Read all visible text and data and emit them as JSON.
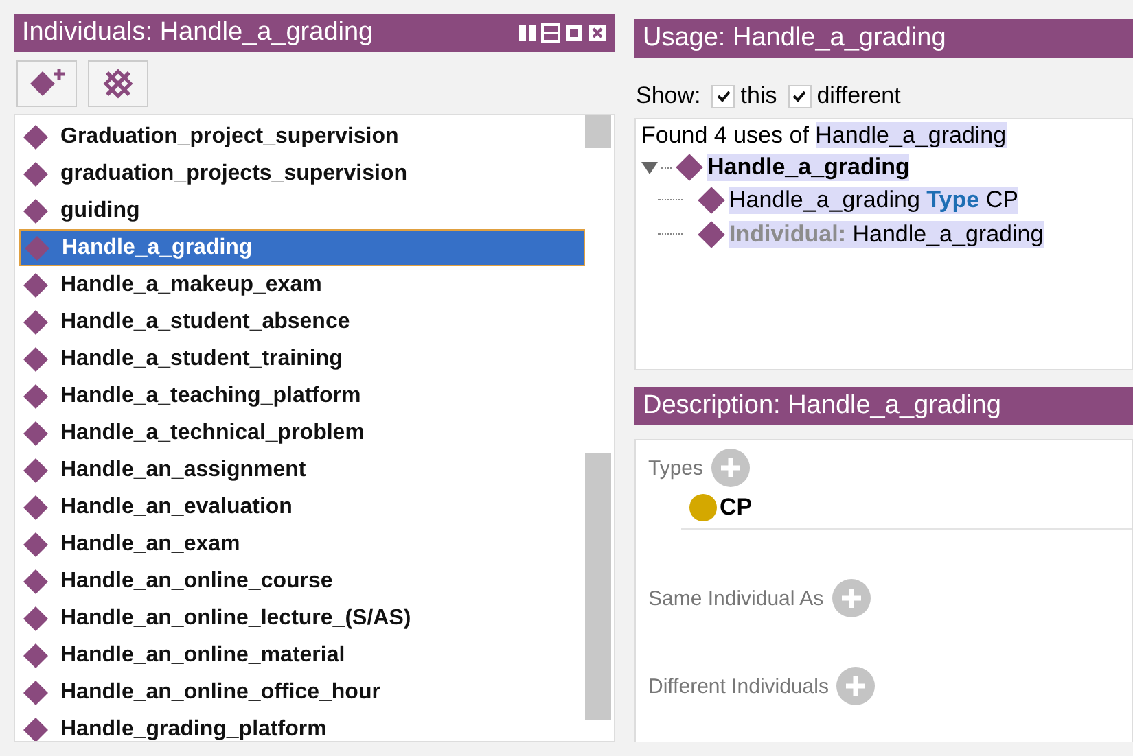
{
  "individuals_panel": {
    "title": "Individuals: Handle_a_grading",
    "items": [
      {
        "label": "Graduation_project_supervision",
        "selected": false
      },
      {
        "label": "graduation_projects_supervision",
        "selected": false
      },
      {
        "label": "guiding",
        "selected": false
      },
      {
        "label": "Handle_a_grading",
        "selected": true
      },
      {
        "label": "Handle_a_makeup_exam",
        "selected": false
      },
      {
        "label": "Handle_a_student_absence",
        "selected": false
      },
      {
        "label": "Handle_a_student_training",
        "selected": false
      },
      {
        "label": "Handle_a_teaching_platform",
        "selected": false
      },
      {
        "label": "Handle_a_technical_problem",
        "selected": false
      },
      {
        "label": "Handle_an_assignment",
        "selected": false
      },
      {
        "label": "Handle_an_evaluation",
        "selected": false
      },
      {
        "label": "Handle_an_exam",
        "selected": false
      },
      {
        "label": "Handle_an_online_course",
        "selected": false
      },
      {
        "label": "Handle_an_online_lecture_(S/AS)",
        "selected": false
      },
      {
        "label": "Handle_an_online_material",
        "selected": false
      },
      {
        "label": "Handle_an_online_office_hour",
        "selected": false
      },
      {
        "label": "Handle_grading_platform",
        "selected": false
      }
    ]
  },
  "usage_panel": {
    "title": "Usage: Handle_a_grading",
    "show_label": "Show:",
    "options": [
      {
        "label": "this",
        "checked": true
      },
      {
        "label": "different",
        "checked": true
      }
    ],
    "found_prefix": "Found 4 uses of",
    "found_name": "Handle_a_grading",
    "tree": {
      "label": "Handle_a_grading",
      "expanded": true,
      "children": [
        {
          "kind": "axiom",
          "subject": "Handle_a_grading",
          "keyword": "Type",
          "object": "CP"
        },
        {
          "kind": "declaration",
          "keyword": "Individual:",
          "subject": "Handle_a_grading"
        }
      ]
    }
  },
  "description_panel": {
    "title": "Description: Handle_a_grading",
    "sections": [
      {
        "label": "Types",
        "items": [
          {
            "label": "CP"
          }
        ]
      },
      {
        "label": "Same Individual As"
      },
      {
        "label": "Different Individuals"
      }
    ]
  }
}
